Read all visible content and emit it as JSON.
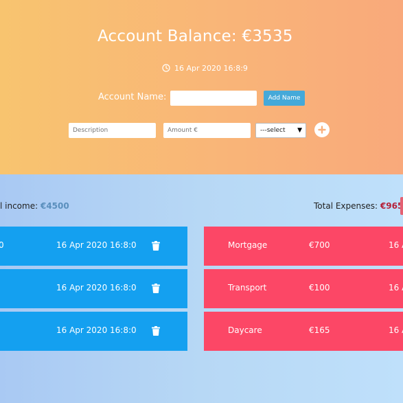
{
  "header": {
    "balance_label": "Account Balance: €3535",
    "timestamp": "16 Apr 2020 16:8:9",
    "clock_icon": "clock-icon"
  },
  "account": {
    "label": "Account Name:",
    "input_value": "",
    "add_button": "Add Name"
  },
  "entry_form": {
    "description_placeholder": "Description",
    "amount_placeholder": "Amount €",
    "select_value": "---select",
    "add_icon": "plus-circle-icon"
  },
  "colors": {
    "income": "#14a0f0",
    "expense": "#fc4766",
    "top_gradient_start": "#f8c46f",
    "top_gradient_end": "#f9a97b"
  },
  "totals": {
    "income_label": "l income: ",
    "income_currency": "€",
    "income_value": "4500",
    "expense_label": "Total Expenses: ",
    "expense_currency": "€",
    "expense_value": "965"
  },
  "income_items": [
    {
      "edge_text": "0",
      "date": "16 Apr 2020 16:8:0",
      "delete_icon": "trash-icon"
    },
    {
      "edge_text": "",
      "date": "16 Apr 2020 16:8:0",
      "delete_icon": "trash-icon"
    },
    {
      "edge_text": "",
      "date": "16 Apr 2020 16:8:0",
      "delete_icon": "trash-icon"
    }
  ],
  "expense_items": [
    {
      "name": "Mortgage",
      "amount": "€700",
      "date": "16 A"
    },
    {
      "name": "Transport",
      "amount": "€100",
      "date": "16 A"
    },
    {
      "name": "Daycare",
      "amount": "€165",
      "date": "16 A"
    }
  ]
}
